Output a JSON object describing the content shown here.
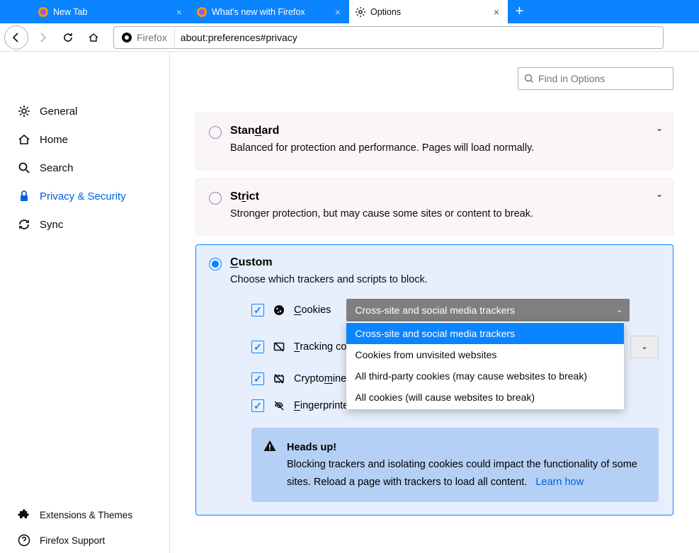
{
  "tabs": [
    {
      "label": "New Tab",
      "active": false
    },
    {
      "label": "What's new with Firefox",
      "active": false
    },
    {
      "label": "Options",
      "active": true
    }
  ],
  "addressbar": {
    "identity": "Firefox",
    "url": "about:preferences#privacy"
  },
  "search": {
    "placeholder": "Find in Options"
  },
  "sidebar": {
    "general": "General",
    "home": "Home",
    "search": "Search",
    "privacy": "Privacy & Security",
    "sync": "Sync",
    "extensions": "Extensions & Themes",
    "support": "Firefox Support"
  },
  "cards": {
    "standard": {
      "title": "Standard",
      "desc": "Balanced for protection and performance. Pages will load normally."
    },
    "strict": {
      "title": "Strict",
      "desc": "Stronger protection, but may cause some sites or content to break."
    },
    "custom": {
      "title": "Custom",
      "desc": "Choose which trackers and scripts to block.",
      "opts": {
        "cookies": "Cookies",
        "tracking": "Tracking con",
        "crypto": "Cryptominer",
        "fingerprint": "Fingerprinters"
      },
      "cookies_select": {
        "current": "Cross-site and social media trackers",
        "options": [
          "Cross-site and social media trackers",
          "Cookies from unvisited websites",
          "All third-party cookies (may cause websites to break)",
          "All cookies (will cause websites to break)"
        ]
      }
    }
  },
  "alert": {
    "title": "Heads up!",
    "body": "Blocking trackers and isolating cookies could impact the functionality of some sites. Reload a page with trackers to load all content.",
    "link": "Learn how"
  }
}
